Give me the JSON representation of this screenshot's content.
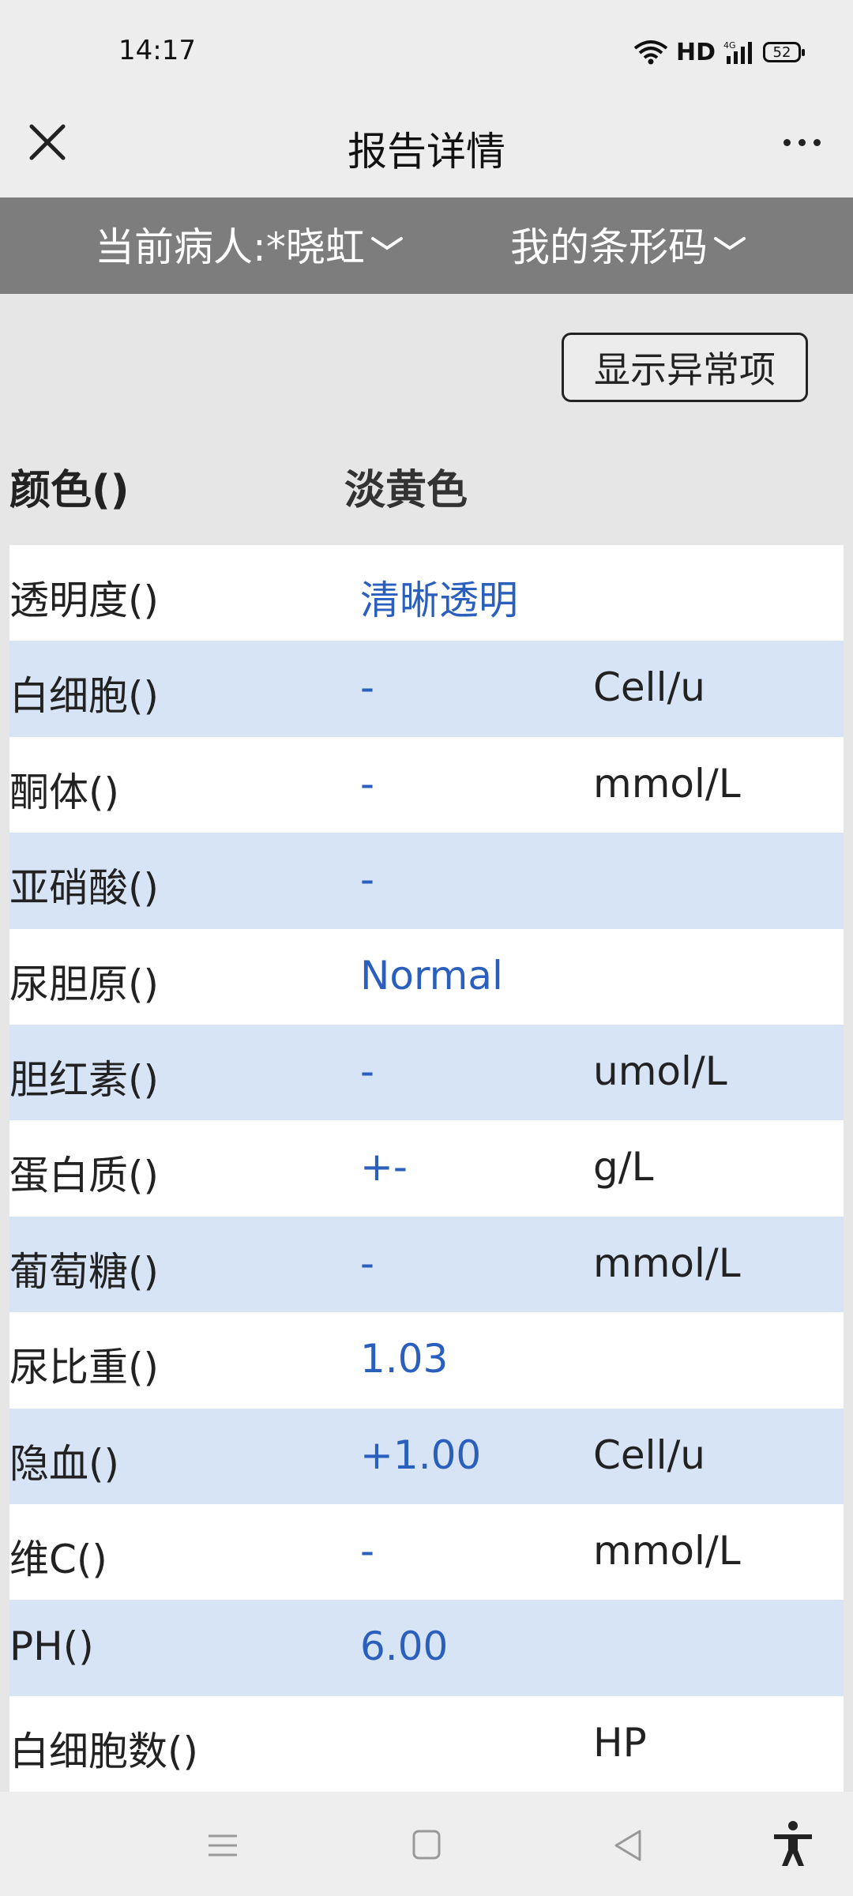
{
  "status_bar": {
    "time": "14:17",
    "network_label": "HD",
    "cellular_label": "4G",
    "battery": "52"
  },
  "header": {
    "title": "报告详情",
    "close_icon": "close-icon",
    "more_icon": "more-dots-icon"
  },
  "selectors": {
    "patient_label": "当前病人:*晓虹",
    "barcode_label": "我的条形码"
  },
  "filter": {
    "show_abnormal_label": "显示异常项"
  },
  "report": {
    "header": {
      "name": "颜色()",
      "value": "淡黄色"
    },
    "rows": [
      {
        "name": "透明度()",
        "value": "清晰透明",
        "unit": ""
      },
      {
        "name": "白细胞()",
        "value": "-",
        "unit": "Cell/u"
      },
      {
        "name": "酮体()",
        "value": "-",
        "unit": "mmol/L"
      },
      {
        "name": "亚硝酸()",
        "value": "-",
        "unit": ""
      },
      {
        "name": "尿胆原()",
        "value": "Normal",
        "unit": ""
      },
      {
        "name": "胆红素()",
        "value": "-",
        "unit": "umol/L"
      },
      {
        "name": "蛋白质()",
        "value": "+-",
        "unit": "g/L"
      },
      {
        "name": "葡萄糖()",
        "value": "-",
        "unit": "mmol/L"
      },
      {
        "name": "尿比重()",
        "value": "1.03",
        "unit": ""
      },
      {
        "name": "隐血()",
        "value": "+1.00",
        "unit": "Cell/u"
      },
      {
        "name": "维C()",
        "value": "-",
        "unit": "mmol/L"
      },
      {
        "name": "PH()",
        "value": "6.00",
        "unit": ""
      },
      {
        "name": "白细胞数()",
        "value": "",
        "unit": "HP"
      }
    ]
  },
  "colors": {
    "value_text": "#2a5fbd",
    "row_alt": "#d6e4f6",
    "selector_bar": "#7d7d7d"
  }
}
